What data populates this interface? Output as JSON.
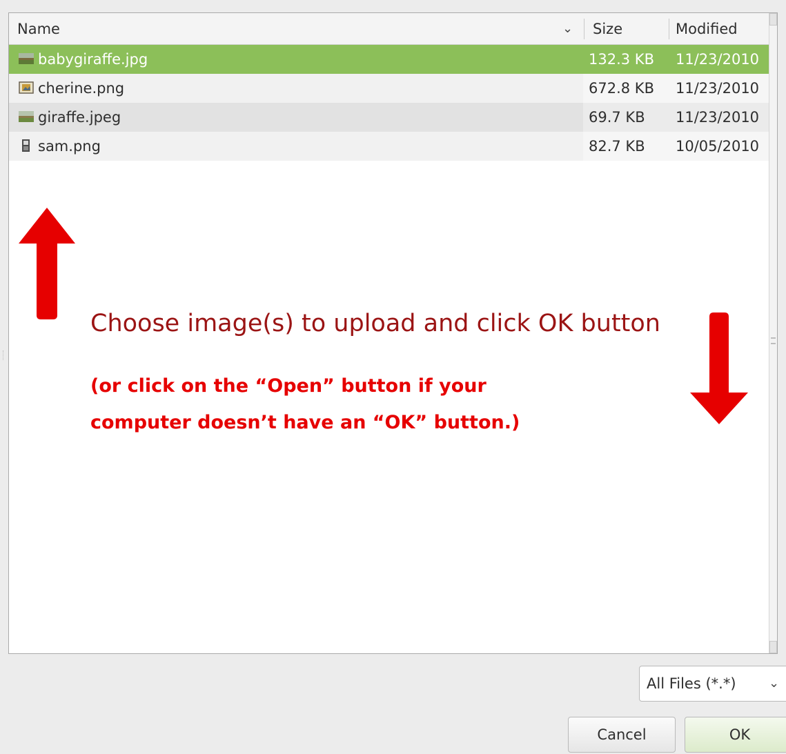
{
  "file_list": {
    "columns": {
      "name": "Name",
      "size": "Size",
      "modified": "Modified",
      "sort_indicator": "chevron-down-icon"
    },
    "rows": [
      {
        "icon": "landscape-image-icon",
        "name": "babygiraffe.jpg",
        "size": "132.3 KB",
        "modified": "11/23/2010",
        "selected": true
      },
      {
        "icon": "picture-frame-icon",
        "name": "cherine.png",
        "size": "672.8 KB",
        "modified": "11/23/2010",
        "selected": false
      },
      {
        "icon": "landscape-image-icon",
        "name": "giraffe.jpeg",
        "size": "69.7 KB",
        "modified": "11/23/2010",
        "selected": false
      },
      {
        "icon": "portrait-image-icon",
        "name": "sam.png",
        "size": "82.7 KB",
        "modified": "10/05/2010",
        "selected": false
      }
    ]
  },
  "annotations": {
    "instruction": "Choose image(s) to upload and click OK button",
    "note_line1": "(or click on the “Open” button if your",
    "note_line2": "computer doesn’t have an “OK” button.)",
    "arrow_color": "#e60000",
    "instruction_color": "#9b1414"
  },
  "footer": {
    "filter_value": "All Files (*.*)",
    "cancel_label": "Cancel",
    "ok_label": "OK"
  },
  "colors": {
    "selection": "#8cbf59",
    "dialog_bg": "#ececec"
  }
}
